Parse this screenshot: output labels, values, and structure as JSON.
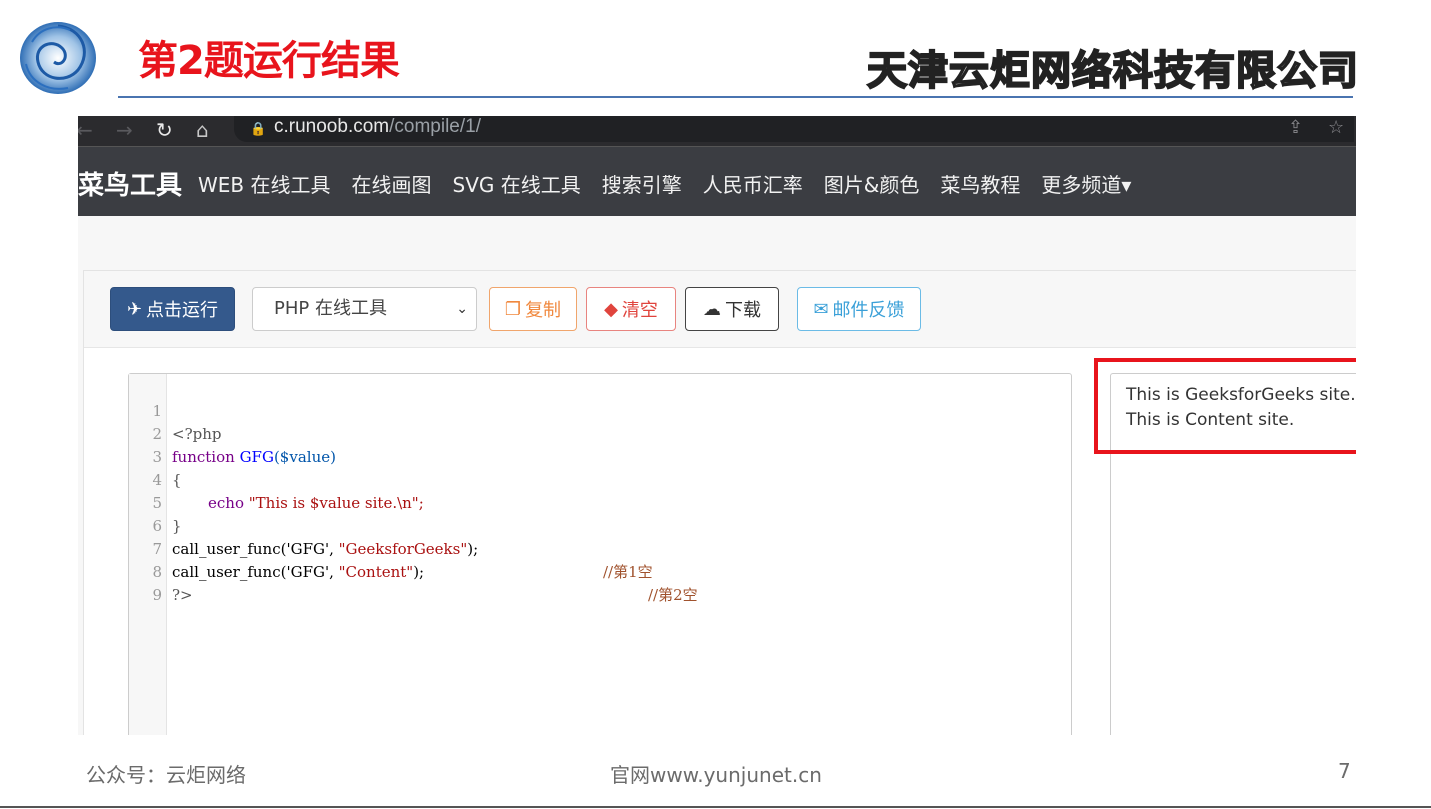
{
  "slide": {
    "title": "第2题运行结果",
    "company": "天津云炬网络科技有限公司"
  },
  "browser": {
    "url_host": "c.runoob.com",
    "url_path": "/compile/1/",
    "icons": [
      "back-arrow-icon",
      "forward-arrow-icon",
      "reload-icon",
      "home-icon",
      "lock-icon",
      "share-icon",
      "star-icon"
    ]
  },
  "site_nav": {
    "brand": "菜鸟工具",
    "items": [
      "WEB 在线工具",
      "在线画图",
      "SVG 在线工具",
      "搜索引擎",
      "人民币汇率",
      "图片&颜色",
      "菜鸟教程",
      "更多频道▾"
    ]
  },
  "toolbar": {
    "run_label": "点击运行",
    "language_selected": "PHP 在线工具",
    "copy_label": "复制",
    "clear_label": "清空",
    "download_label": "下载",
    "feedback_label": "邮件反馈"
  },
  "editor": {
    "line_numbers": [
      "1",
      "2",
      "3",
      "4",
      "5",
      "6",
      "7",
      "8",
      "9"
    ],
    "lines": {
      "l1": "<?php",
      "l2_kw": "function",
      "l2_fn": "GFG",
      "l2_var": "($value)",
      "l3": "{",
      "l4_kw": "echo",
      "l4_str": "\"This is $value site.\\n\";",
      "l5": "}",
      "l6_code": "call_user_func('GFG', ",
      "l6_str": "\"GeeksforGeeks\"",
      "l6_end": ");",
      "l6_comment": "//第1空",
      "l7_code": "call_user_func('GFG', ",
      "l7_str": "\"Content\"",
      "l7_end": ");",
      "l7_comment": "//第2空",
      "l8": "?>"
    }
  },
  "output": {
    "lines": [
      "This is GeeksforGeeks site.",
      "This is Content site."
    ]
  },
  "footer": {
    "left": "公众号：云炬网络",
    "center": "官网www.yunjunet.cn",
    "page_number": "7"
  },
  "colors": {
    "title_red": "#e8141c",
    "nav_bg": "#3b3d42",
    "run_button": "#34598c",
    "highlight_box": "#e8141c"
  }
}
